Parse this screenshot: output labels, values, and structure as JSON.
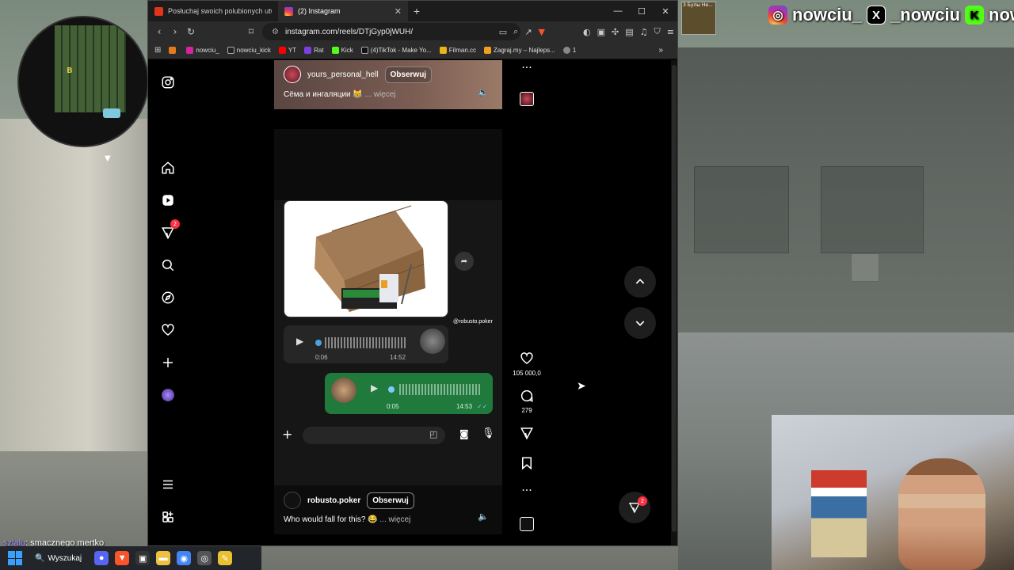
{
  "browser": {
    "tabs": [
      {
        "label": "Posłuchaj swoich polubionych utwor",
        "favicon_color": "#e2331b",
        "active": false
      },
      {
        "label": "(2) Instagram",
        "favicon_color": "#d6249f",
        "active": true
      }
    ],
    "url": "instagram.com/reels/DTjGyp0jWUH/",
    "bookmarks": [
      {
        "label": "",
        "color": "#e87a1e"
      },
      {
        "label": "nowciu_",
        "color": "#d6249f"
      },
      {
        "label": "nowciu_kick",
        "color": "#222222"
      },
      {
        "label": "YT",
        "color": "#ff0000"
      },
      {
        "label": "Rat",
        "color": "#7b3fe4"
      },
      {
        "label": "Kick",
        "color": "#53fc18"
      },
      {
        "label": "(4)TikTok - Make Yo...",
        "color": "#111111"
      },
      {
        "label": "Filman.cc",
        "color": "#e8b51d"
      },
      {
        "label": "Zagraj.my – Najleps...",
        "color": "#f0a020"
      },
      {
        "label": "1",
        "color": "#888888"
      }
    ]
  },
  "instagram": {
    "nav_badges": {
      "notifications": "2",
      "messages_fab": "2"
    },
    "reel_prev": {
      "username": "yours_personal_hell",
      "follow_label": "Obserwuj",
      "caption": "Сёма и ингаляции 😹",
      "more": "... więcej"
    },
    "reel_current": {
      "username": "robusto.poker",
      "follow_label": "Obserwuj",
      "caption": "Who would fall for this? 😂",
      "more": "... więcej",
      "watermark": "@robusto.poker",
      "voice_in": {
        "duration": "0:06",
        "time": "14:52"
      },
      "voice_out": {
        "duration": "0:05",
        "time": "14:53"
      }
    },
    "actions": {
      "likes": "105 000,0",
      "comments": "279"
    }
  },
  "overlay": {
    "socials": [
      "nowciu_",
      "_nowciu",
      "nowciu"
    ],
    "chat_user": "szlalu",
    "chat_message": ": smacznego mertko",
    "thumb_label": "3 Булы Не..."
  },
  "taskbar": {
    "search_label": "Wyszukaj"
  },
  "colors": {
    "ig_like": "#ff3040",
    "wa_green": "#1f7a3c",
    "kick": "#53fc18"
  }
}
